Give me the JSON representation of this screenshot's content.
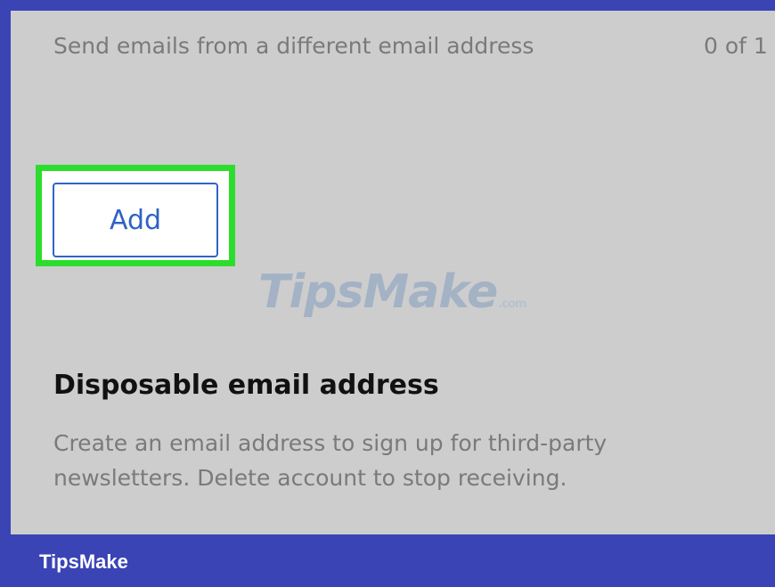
{
  "send_from": {
    "description": "Send emails from a different email address",
    "counter": "0 of 1",
    "add_label": "Add"
  },
  "watermark": {
    "main": "TipsMake",
    "suffix": ".com"
  },
  "disposable": {
    "title": "Disposable email address",
    "description": "Create an email address to sign up for third-party newsletters. Delete account to stop receiving."
  },
  "footer": {
    "brand": "TipsMake"
  },
  "colors": {
    "frame": "#3a44b5",
    "panel": "#cdcdcd",
    "highlight": "#2ddd2d",
    "button_text": "#2f62c4"
  }
}
